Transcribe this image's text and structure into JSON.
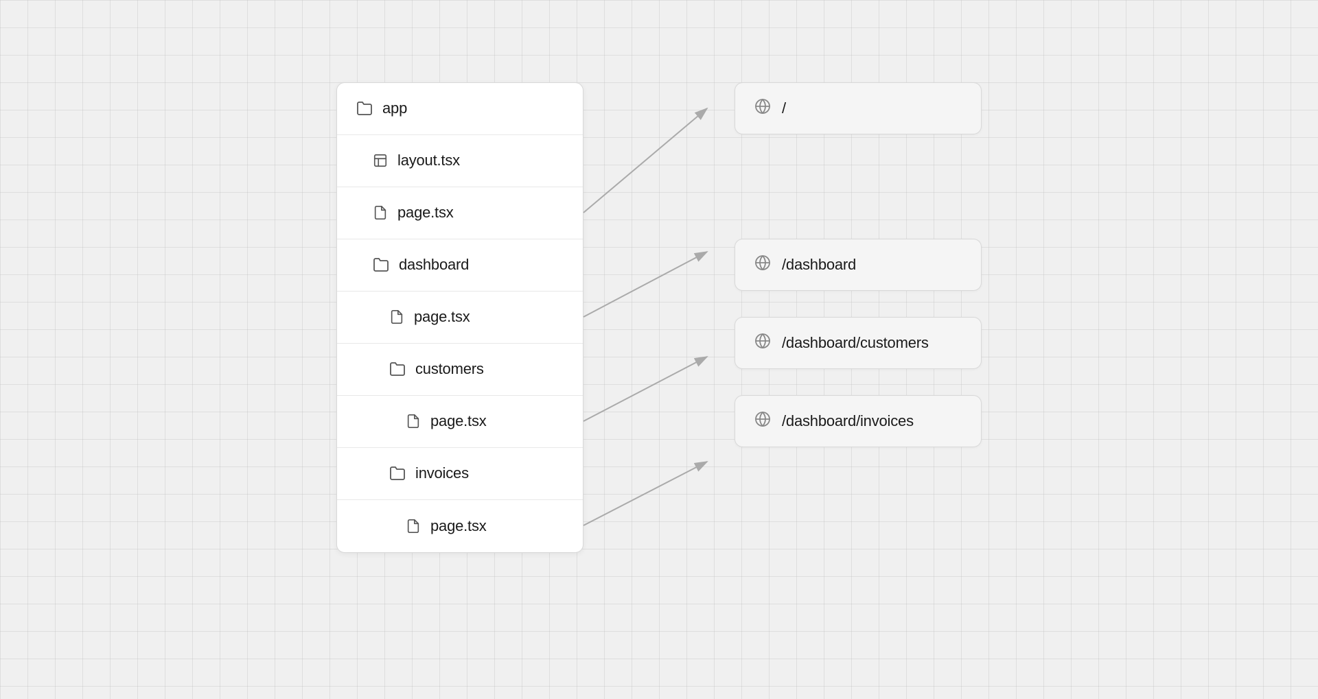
{
  "fileTree": {
    "rows": [
      {
        "id": "app",
        "label": "app",
        "indent": 0,
        "icon": "folder",
        "hasArrow": false
      },
      {
        "id": "layout",
        "label": "layout.tsx",
        "indent": 1,
        "icon": "layout-file",
        "hasArrow": false
      },
      {
        "id": "page-root",
        "label": "page.tsx",
        "indent": 1,
        "icon": "file",
        "hasArrow": true,
        "arrowTarget": "route-root"
      },
      {
        "id": "dashboard",
        "label": "dashboard",
        "indent": 1,
        "icon": "folder",
        "hasArrow": false
      },
      {
        "id": "page-dashboard",
        "label": "page.tsx",
        "indent": 2,
        "icon": "file",
        "hasArrow": true,
        "arrowTarget": "route-dashboard"
      },
      {
        "id": "customers",
        "label": "customers",
        "indent": 2,
        "icon": "folder",
        "hasArrow": false
      },
      {
        "id": "page-customers",
        "label": "page.tsx",
        "indent": 3,
        "icon": "file",
        "hasArrow": true,
        "arrowTarget": "route-customers"
      },
      {
        "id": "invoices",
        "label": "invoices",
        "indent": 2,
        "icon": "folder",
        "hasArrow": false
      },
      {
        "id": "page-invoices",
        "label": "page.tsx",
        "indent": 3,
        "icon": "file",
        "hasArrow": true,
        "arrowTarget": "route-invoices"
      }
    ]
  },
  "routes": [
    {
      "id": "route-root",
      "path": "/"
    },
    {
      "id": "route-dashboard",
      "path": "/dashboard"
    },
    {
      "id": "route-customers",
      "path": "/dashboard/customers"
    },
    {
      "id": "route-invoices",
      "path": "/dashboard/invoices"
    }
  ],
  "icons": {
    "folder": "folder",
    "file": "file",
    "layout-file": "layout-file",
    "globe": "globe"
  }
}
